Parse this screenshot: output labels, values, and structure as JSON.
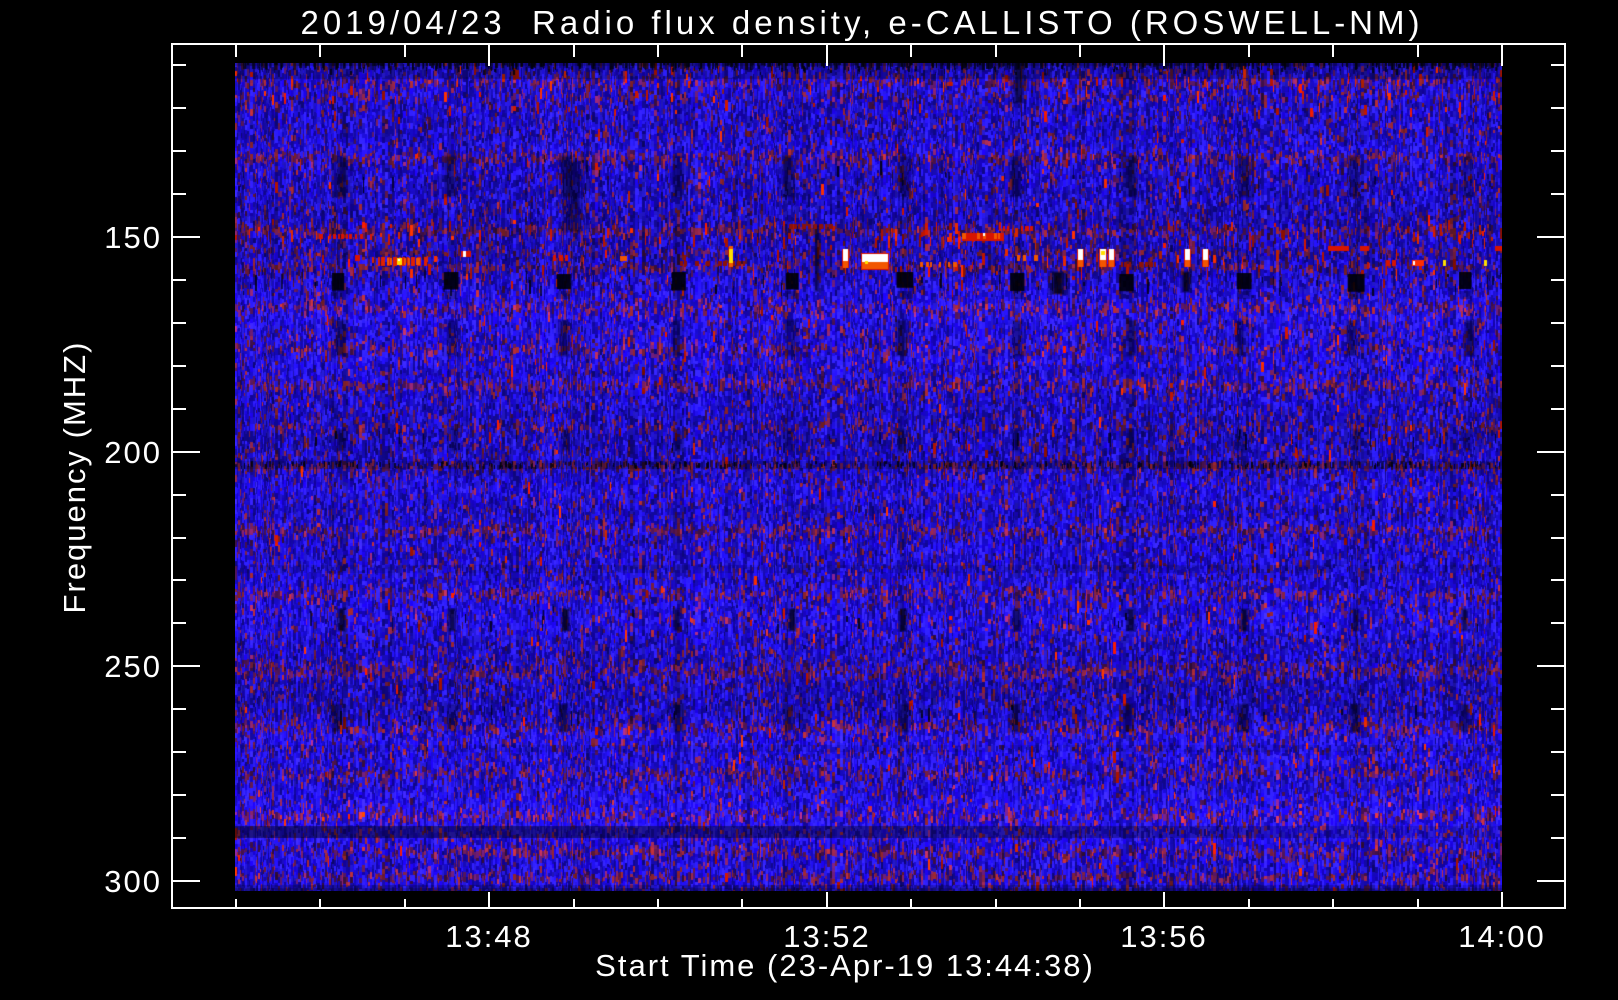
{
  "title": "2019/04/23  Radio flux density, e-CALLISTO (ROSWELL-NM)",
  "colors": {
    "background": "#000000",
    "frame": "#ffffff",
    "text": "#ffffff",
    "base_blue": "#1d0ce6"
  },
  "chart_data": {
    "type": "heatmap",
    "subtype": "radio-spectrogram",
    "title": "2019/04/23  Radio flux density, e-CALLISTO (ROSWELL-NM)",
    "station": "ROSWELL-NM",
    "instrument": "e-CALLISTO",
    "date": "2019/04/23",
    "xlabel": "Start Time (23-Apr-19 13:44:38)",
    "ylabel": "Frequency (MHZ)",
    "x_axis": {
      "major_tick_labels": [
        "13:48",
        "13:52",
        "13:56",
        "14:00"
      ],
      "minor_tick_interval_s": 60,
      "start_time": "13:44:38",
      "end_time": "14:00"
    },
    "y_axis": {
      "major_ticks": [
        150,
        200,
        250,
        300
      ],
      "minor_step_mhz": 10,
      "freq_range_mhz": [
        109.5,
        302.3
      ],
      "unit": "MHZ"
    },
    "legend": "none",
    "grid": "off",
    "noise": {
      "seed": 1337,
      "blue_palette": [
        "#1803c8",
        "#2110ee",
        "#2b1bfc",
        "#170ab6",
        "#2e20ff",
        "#1208a0"
      ],
      "maroon_palette": [
        "#611a6e",
        "#4f1454",
        "#7a2060",
        "#8a2446",
        "#3f1048",
        "#96262e"
      ],
      "red_palette": [
        "#d81800",
        "#ff3000",
        "#b01400"
      ],
      "base_maroon_weight": 0.14,
      "maroon_stripes": [
        [
          113.5,
          1.6,
          0.4
        ],
        [
          117,
          1.2,
          0.3
        ],
        [
          131,
          1.9,
          0.45
        ],
        [
          148,
          1.6,
          0.5
        ],
        [
          153,
          1.0,
          0.35
        ],
        [
          156.5,
          1.3,
          0.4
        ],
        [
          166,
          1.8,
          0.4
        ],
        [
          175.5,
          1.5,
          0.38
        ],
        [
          184,
          2.0,
          0.42
        ],
        [
          193.8,
          1.2,
          0.32
        ],
        [
          202.9,
          1.0,
          0.55
        ],
        [
          217.8,
          1.8,
          0.4
        ],
        [
          232.7,
          1.6,
          0.38
        ],
        [
          250.4,
          2.4,
          0.42
        ],
        [
          263.7,
          2.0,
          0.4
        ],
        [
          274.4,
          1.7,
          0.38
        ],
        [
          284.2,
          1.6,
          0.42
        ],
        [
          292.8,
          1.7,
          0.45
        ],
        [
          298.6,
          1.4,
          0.4
        ]
      ],
      "red_bands": [
        [
          146,
          150.6,
          0.05
        ],
        [
          152.8,
          157.6,
          0.03
        ],
        [
          109,
          121,
          0.016
        ]
      ],
      "dark_lanes": [
        [
          110.8,
          2.2,
          0.75
        ],
        [
          203,
          1.0,
          0.8
        ],
        [
          227.2,
          0.9,
          0.85
        ],
        [
          269,
          0.9,
          0.85
        ],
        [
          301.6,
          0.8,
          0.75
        ]
      ],
      "fade_lane": {
        "f_center": 288.6,
        "f_halfwidth": 1.4,
        "alpha_left": 0.5,
        "alpha_right": 0.12
      },
      "dash_scatter": [
        [
          157.5,
          164,
          70
        ],
        [
          131,
          141,
          30
        ],
        [
          195,
          200,
          25
        ],
        [
          202.1,
          204.2,
          330
        ],
        [
          236,
          242.5,
          30
        ],
        [
          259,
          265,
          25
        ],
        [
          109.5,
          112.5,
          130
        ]
      ]
    },
    "interference": {
      "first_offset_s": 74,
      "period_s": 80.2,
      "bands": [
        [
          131,
          141,
          0.32,
          20
        ],
        [
          157.8,
          163,
          0.9,
          14
        ],
        [
          169,
          178,
          0.3,
          18
        ],
        [
          194.5,
          200,
          0.26,
          14
        ],
        [
          236.5,
          242,
          0.62,
          11
        ],
        [
          258.5,
          265.5,
          0.34,
          16
        ]
      ],
      "black_blob_band": [
        157.9,
        162.6
      ],
      "extra_smudges": [
        [
          241,
          132,
          149,
          0.3,
          26
        ],
        [
          414,
          147,
          163,
          0.4,
          8
        ],
        [
          557,
          109,
          119,
          0.5,
          16
        ],
        [
          585,
          158,
          163.5,
          0.85,
          20
        ],
        [
          676,
          158,
          163,
          0.8,
          12
        ]
      ]
    },
    "bursts": [
      [
        60,
        30,
        149.8,
        1.2,
        "red-dashes"
      ],
      [
        85,
        4,
        155,
        1.4,
        "red"
      ],
      [
        102,
        33,
        155.5,
        2.2,
        "bright-mix"
      ],
      [
        161,
        7,
        154,
        1.5,
        "white-dot"
      ],
      [
        226,
        16,
        155,
        1.3,
        "red-dashes"
      ],
      [
        274,
        5,
        155,
        1.2,
        "orange"
      ],
      [
        316,
        46,
        156,
        1.2,
        "dark-red-dashes"
      ],
      [
        351,
        6,
        154.5,
        4.8,
        "yellow-bar"
      ],
      [
        394,
        29,
        147.5,
        1.2,
        "dark-red-dashes"
      ],
      [
        432,
        4,
        155,
        4.4,
        "white-bar"
      ],
      [
        446,
        18,
        155.5,
        3.4,
        "white-block"
      ],
      [
        487,
        28,
        156.2,
        1.2,
        "orange-dashes"
      ],
      [
        517,
        30,
        150,
        1.8,
        "red-orange"
      ],
      [
        546,
        20,
        148,
        1.2,
        "red-dashes"
      ],
      [
        556,
        16,
        155,
        1.3,
        "orange-dashes"
      ],
      [
        599,
        4,
        155,
        4.2,
        "white-bar"
      ],
      [
        615,
        4,
        155,
        4.2,
        "white-bar-yellow"
      ],
      [
        621,
        4,
        155,
        4.2,
        "white-bar"
      ],
      [
        630,
        26,
        156.3,
        1.1,
        "dark-red-dashes"
      ],
      [
        675,
        4,
        155,
        4.2,
        "white-bar"
      ],
      [
        688,
        4,
        155,
        4.2,
        "white-bar"
      ],
      [
        721,
        3,
        151,
        4.5,
        "red-streak"
      ],
      [
        777,
        15,
        152.5,
        1.2,
        "red"
      ],
      [
        800,
        6,
        152.5,
        1.2,
        "red"
      ],
      [
        816,
        10,
        156,
        1.3,
        "red-dashes"
      ],
      [
        837,
        8,
        156,
        1.5,
        "bright-red"
      ],
      [
        859,
        3,
        156,
        1.5,
        "yellow-dot"
      ],
      [
        888,
        3,
        156,
        1.5,
        "yellow-dot"
      ],
      [
        896,
        5,
        152.5,
        1.2,
        "red"
      ]
    ],
    "burst_colors": {
      "red": "#d81400",
      "dark-red": "#8c1208",
      "orange": "#f25600",
      "yellow": "#ffdf00",
      "white": "#ffffff",
      "bright-red": "#ff2e00"
    }
  }
}
